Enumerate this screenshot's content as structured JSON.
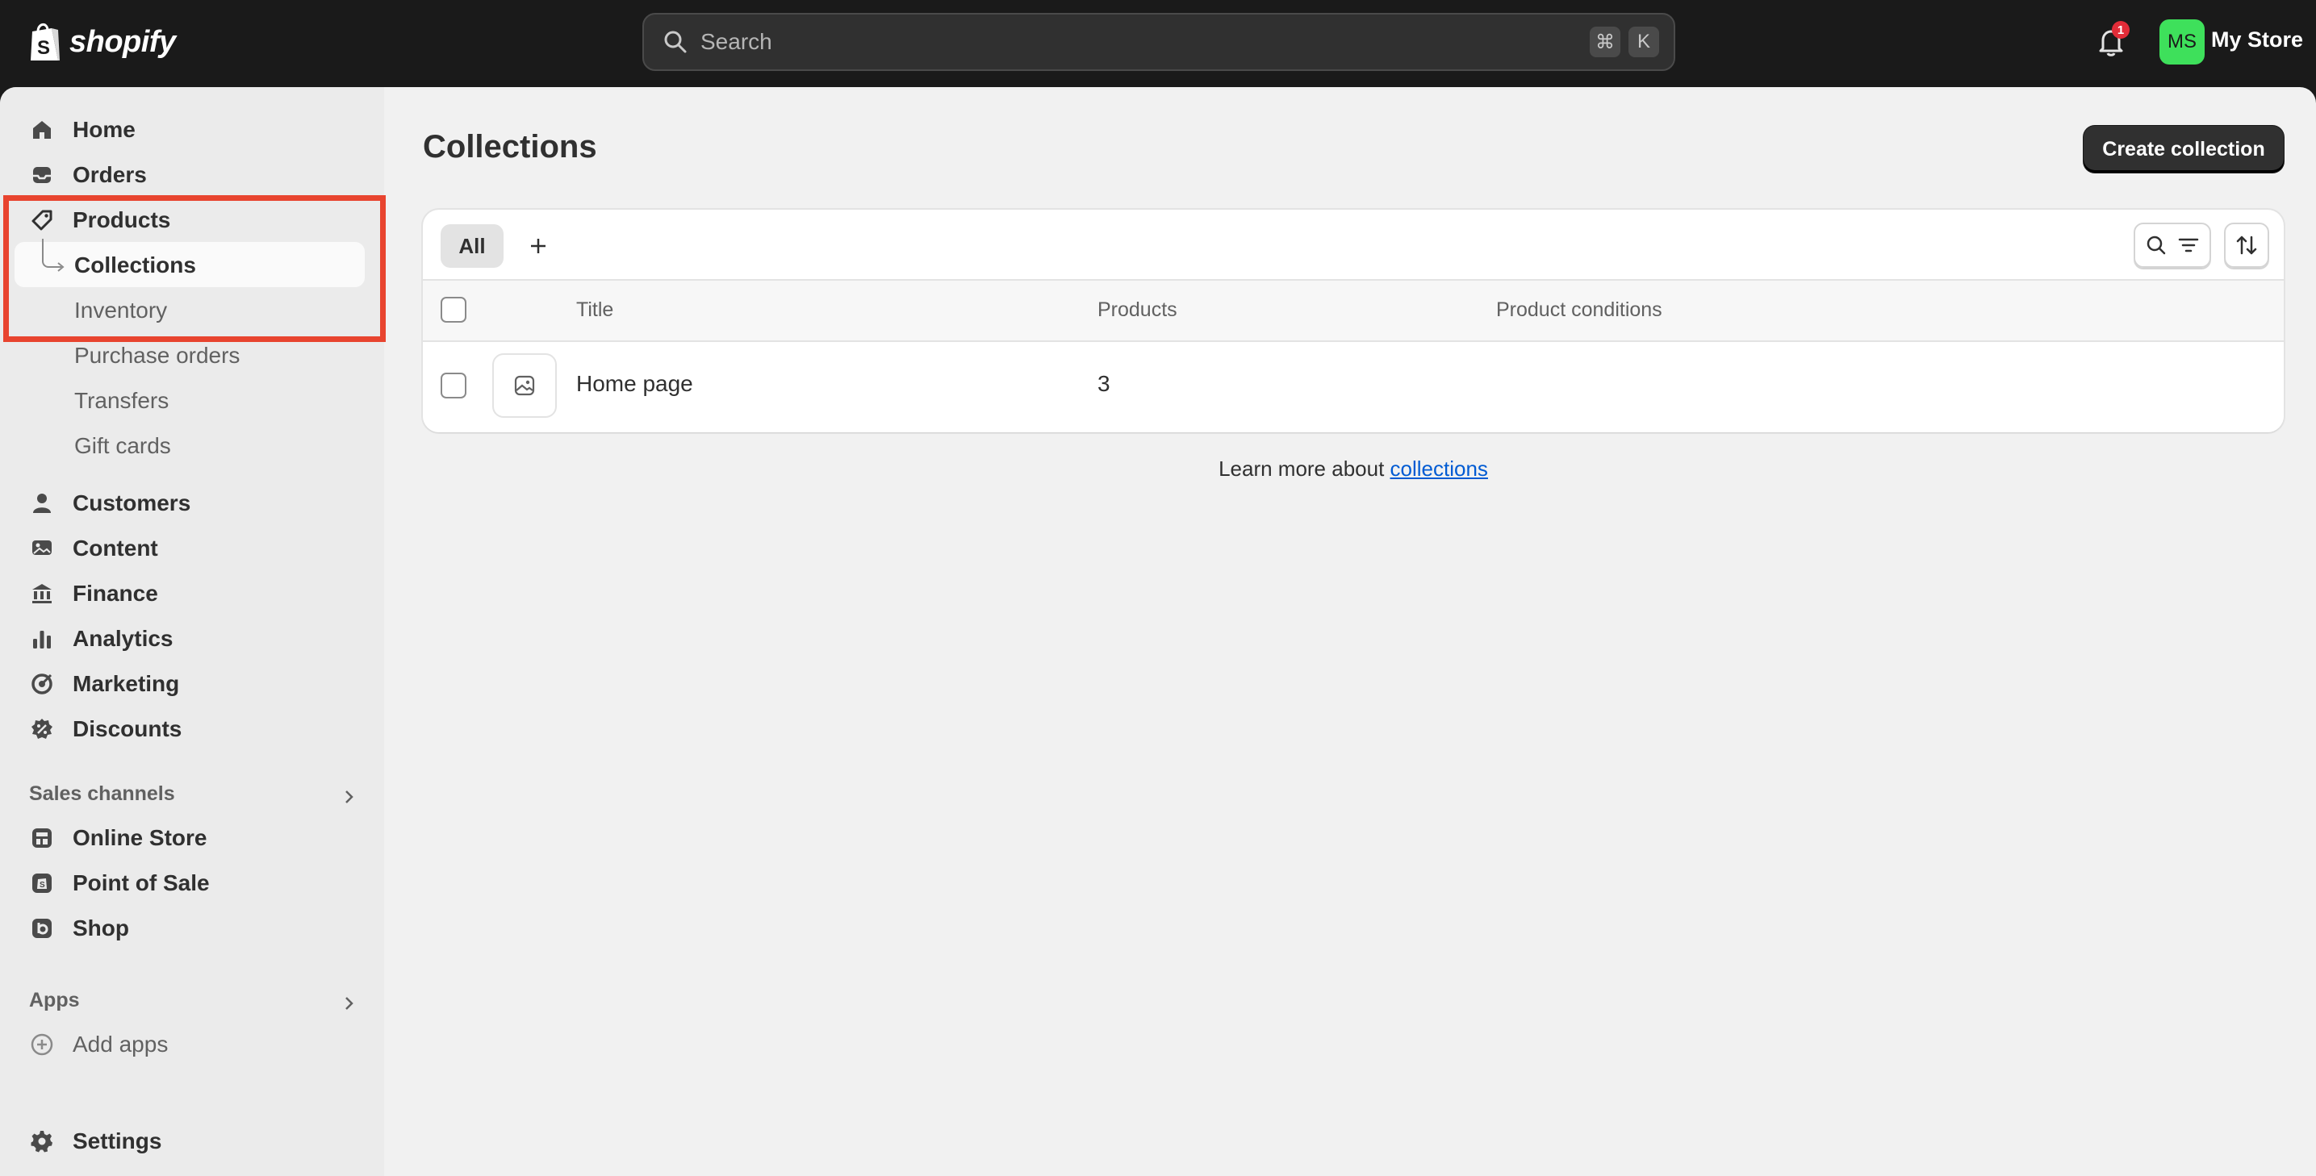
{
  "topbar": {
    "logo_text": "shopify",
    "search_placeholder": "Search",
    "shortcut_keys": [
      "⌘",
      "K"
    ],
    "notification_count": "1",
    "avatar_initials": "MS",
    "store_name": "My Store"
  },
  "sidebar": {
    "items": [
      {
        "label": "Home",
        "icon": "home-icon"
      },
      {
        "label": "Orders",
        "icon": "inbox-icon"
      },
      {
        "label": "Products",
        "icon": "tag-icon"
      }
    ],
    "product_subitems": [
      {
        "label": "Collections",
        "active": true
      },
      {
        "label": "Inventory"
      },
      {
        "label": "Purchase orders"
      },
      {
        "label": "Transfers"
      },
      {
        "label": "Gift cards"
      }
    ],
    "items2": [
      {
        "label": "Customers",
        "icon": "person-icon"
      },
      {
        "label": "Content",
        "icon": "content-icon"
      },
      {
        "label": "Finance",
        "icon": "bank-icon"
      },
      {
        "label": "Analytics",
        "icon": "chart-icon"
      },
      {
        "label": "Marketing",
        "icon": "target-icon"
      },
      {
        "label": "Discounts",
        "icon": "discount-icon"
      }
    ],
    "sales_channels_label": "Sales channels",
    "channels": [
      {
        "label": "Online Store",
        "icon": "store-icon"
      },
      {
        "label": "Point of Sale",
        "icon": "pos-icon"
      },
      {
        "label": "Shop",
        "icon": "shop-icon"
      }
    ],
    "apps_label": "Apps",
    "add_apps_label": "Add apps",
    "settings_label": "Settings"
  },
  "main": {
    "title": "Collections",
    "create_button": "Create collection",
    "tabs": [
      {
        "label": "All"
      }
    ],
    "columns": [
      "Title",
      "Products",
      "Product conditions"
    ],
    "rows": [
      {
        "title": "Home page",
        "products": "3",
        "conditions": ""
      }
    ],
    "learn_text": "Learn more about ",
    "learn_link": "collections"
  },
  "colors": {
    "highlight": "#e8442f",
    "avatar_bg": "#3ee05b",
    "link": "#005bd3"
  }
}
